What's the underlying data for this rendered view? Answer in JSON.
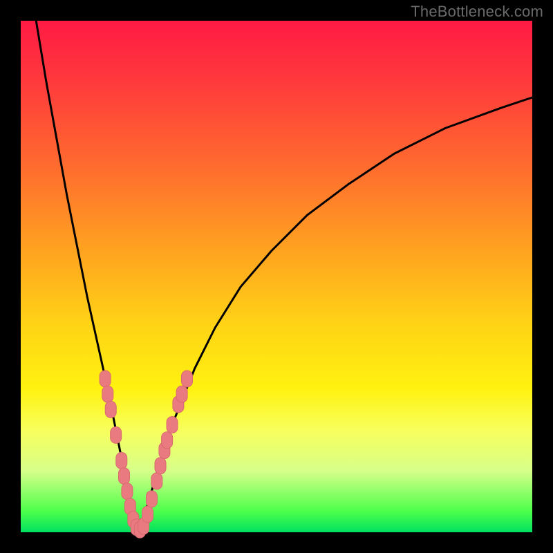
{
  "watermark": "TheBottleneck.com",
  "colors": {
    "background_frame": "#000000",
    "curve": "#000000",
    "marker_fill": "#e97a7f",
    "marker_stroke": "#d86a70",
    "gradient_stops": [
      "#ff1a44",
      "#ff3a3c",
      "#ff6a2f",
      "#ffa320",
      "#ffd515",
      "#fff210",
      "#f8ff5c",
      "#d7ff8a",
      "#4bff4b",
      "#00e060"
    ]
  },
  "chart_data": {
    "type": "line",
    "title": "",
    "xlabel": "",
    "ylabel": "",
    "xlim": [
      0,
      100
    ],
    "ylim": [
      0,
      100
    ],
    "grid": false,
    "legend": false,
    "comment": "Y is bottleneck percentage (0 at bottom = no bottleneck, 100 at top = severe). X is an unlabeled performance ratio. The curve is V-shaped with minimum near x≈23.",
    "series": [
      {
        "name": "left-branch",
        "x": [
          3,
          5,
          7,
          9,
          11,
          13,
          15,
          17,
          19,
          20,
          21,
          22,
          23
        ],
        "y": [
          100,
          88,
          77,
          66,
          56,
          46,
          37,
          28,
          18,
          13,
          8,
          3,
          0
        ]
      },
      {
        "name": "right-branch",
        "x": [
          23,
          25,
          27,
          30,
          34,
          38,
          43,
          49,
          56,
          64,
          73,
          83,
          94,
          100
        ],
        "y": [
          0,
          6,
          13,
          22,
          32,
          40,
          48,
          55,
          62,
          68,
          74,
          79,
          83,
          85
        ]
      }
    ],
    "markers": {
      "comment": "Salmon pill-shaped markers scattered along the lower portion of the V, roughly between y=0 and y=30.",
      "points": [
        {
          "x": 16.5,
          "y": 30
        },
        {
          "x": 17.0,
          "y": 27
        },
        {
          "x": 17.6,
          "y": 24
        },
        {
          "x": 18.6,
          "y": 19
        },
        {
          "x": 19.7,
          "y": 14
        },
        {
          "x": 20.2,
          "y": 11
        },
        {
          "x": 20.8,
          "y": 8
        },
        {
          "x": 21.4,
          "y": 5
        },
        {
          "x": 22.0,
          "y": 2.5
        },
        {
          "x": 22.6,
          "y": 1
        },
        {
          "x": 23.3,
          "y": 0.5
        },
        {
          "x": 24.0,
          "y": 1.2
        },
        {
          "x": 24.8,
          "y": 3.5
        },
        {
          "x": 25.6,
          "y": 6.5
        },
        {
          "x": 26.6,
          "y": 10
        },
        {
          "x": 27.3,
          "y": 13
        },
        {
          "x": 28.1,
          "y": 16
        },
        {
          "x": 28.6,
          "y": 18
        },
        {
          "x": 29.6,
          "y": 21
        },
        {
          "x": 30.8,
          "y": 25
        },
        {
          "x": 31.5,
          "y": 27
        },
        {
          "x": 32.5,
          "y": 30
        }
      ]
    }
  }
}
